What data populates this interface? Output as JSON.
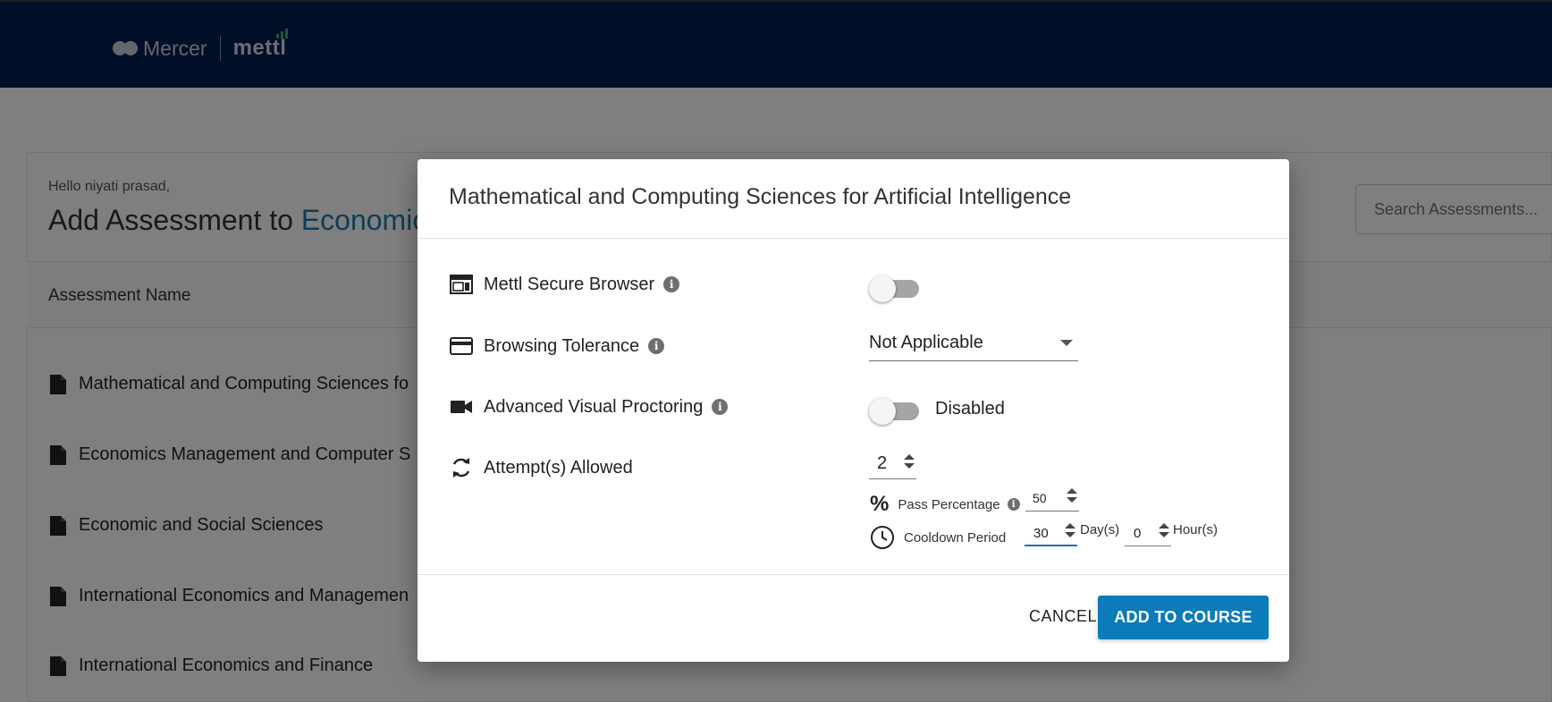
{
  "header": {
    "brand_primary": "Mercer",
    "brand_secondary": "mettl"
  },
  "page": {
    "greeting": "Hello niyati prasad,",
    "title_prefix": "Add Assessment to ",
    "course_name": "Economics",
    "search_placeholder": "Search Assessments...",
    "column_header": "Assessment Name",
    "assessments": [
      "Mathematical and Computing Sciences fo",
      "Economics Management and Computer S",
      "Economic and Social Sciences",
      "International Economics and Managemen",
      "International Economics and Finance"
    ]
  },
  "modal": {
    "title": "Mathematical and Computing Sciences for Artificial Intelligence",
    "settings": {
      "secure_browser": {
        "label": "Mettl Secure Browser",
        "enabled": false
      },
      "browsing_tolerance": {
        "label": "Browsing Tolerance",
        "value": "Not Applicable"
      },
      "visual_proctoring": {
        "label": "Advanced Visual Proctoring",
        "enabled": false,
        "status_text": "Disabled"
      },
      "attempts": {
        "label": "Attempt(s) Allowed",
        "value": "2"
      },
      "pass_percentage": {
        "label": "Pass Percentage",
        "value": "50"
      },
      "cooldown": {
        "label": "Cooldown Period",
        "days": "30",
        "days_unit": "Day(s)",
        "hours": "0",
        "hours_unit": "Hour(s)"
      }
    },
    "buttons": {
      "cancel": "CANCEL",
      "add": "ADD TO COURSE"
    }
  },
  "colors": {
    "header_bg": "#001c4f",
    "accent": "#0b7bba",
    "course_link": "#1f7ab5"
  }
}
